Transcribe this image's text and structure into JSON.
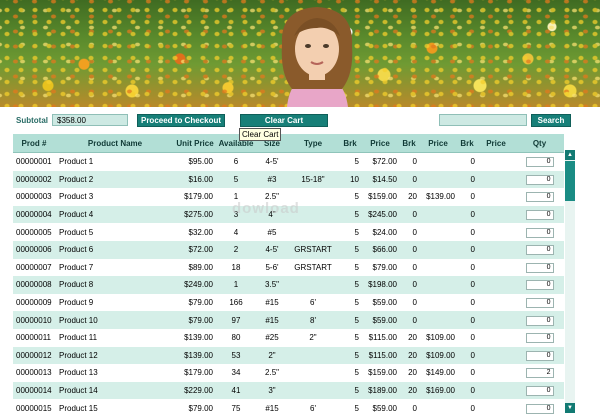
{
  "subtotal": {
    "label": "Subtotal",
    "value": "$358.00"
  },
  "buttons": {
    "checkout": "Proceed to Checkout",
    "clear": "Clear Cart",
    "search": "Search"
  },
  "search": {
    "value": ""
  },
  "tooltip": "Clear Cart",
  "watermark": "dowload",
  "columns": [
    "Prod #",
    "Product Name",
    "Unit Price",
    "Available",
    "Size",
    "Type",
    "Brk",
    "Price",
    "Brk",
    "Price",
    "Brk",
    "Price",
    "Qty"
  ],
  "rows": [
    {
      "prod": "00000001",
      "name": "Product 1",
      "unit": "$95.00",
      "avail": "6",
      "size": "4-5'",
      "type": "",
      "brk1": "5",
      "price1": "$72.00",
      "brk2": "0",
      "price2": "",
      "brk3": "0",
      "price3": "",
      "qty": "0"
    },
    {
      "prod": "00000002",
      "name": "Product 2",
      "unit": "$16.00",
      "avail": "5",
      "size": "#3",
      "type": "15-18\"",
      "brk1": "10",
      "price1": "$14.50",
      "brk2": "0",
      "price2": "",
      "brk3": "0",
      "price3": "",
      "qty": "0"
    },
    {
      "prod": "00000003",
      "name": "Product 3",
      "unit": "$179.00",
      "avail": "1",
      "size": "2.5\"",
      "type": "",
      "brk1": "5",
      "price1": "$159.00",
      "brk2": "20",
      "price2": "$139.00",
      "brk3": "0",
      "price3": "",
      "qty": "0"
    },
    {
      "prod": "00000004",
      "name": "Product 4",
      "unit": "$275.00",
      "avail": "3",
      "size": "4\"",
      "type": "",
      "brk1": "5",
      "price1": "$245.00",
      "brk2": "0",
      "price2": "",
      "brk3": "0",
      "price3": "",
      "qty": "0"
    },
    {
      "prod": "00000005",
      "name": "Product 5",
      "unit": "$32.00",
      "avail": "4",
      "size": "#5",
      "type": "",
      "brk1": "5",
      "price1": "$24.00",
      "brk2": "0",
      "price2": "",
      "brk3": "0",
      "price3": "",
      "qty": "0"
    },
    {
      "prod": "00000006",
      "name": "Product 6",
      "unit": "$72.00",
      "avail": "2",
      "size": "4-5'",
      "type": "GRSTART",
      "brk1": "5",
      "price1": "$66.00",
      "brk2": "0",
      "price2": "",
      "brk3": "0",
      "price3": "",
      "qty": "0"
    },
    {
      "prod": "00000007",
      "name": "Product 7",
      "unit": "$89.00",
      "avail": "18",
      "size": "5-6'",
      "type": "GRSTART",
      "brk1": "5",
      "price1": "$79.00",
      "brk2": "0",
      "price2": "",
      "brk3": "0",
      "price3": "",
      "qty": "0"
    },
    {
      "prod": "00000008",
      "name": "Product 8",
      "unit": "$249.00",
      "avail": "1",
      "size": "3.5\"",
      "type": "",
      "brk1": "5",
      "price1": "$198.00",
      "brk2": "0",
      "price2": "",
      "brk3": "0",
      "price3": "",
      "qty": "0"
    },
    {
      "prod": "00000009",
      "name": "Product 9",
      "unit": "$79.00",
      "avail": "166",
      "size": "#15",
      "type": "6'",
      "brk1": "5",
      "price1": "$59.00",
      "brk2": "0",
      "price2": "",
      "brk3": "0",
      "price3": "",
      "qty": "0"
    },
    {
      "prod": "00000010",
      "name": "Product 10",
      "unit": "$79.00",
      "avail": "97",
      "size": "#15",
      "type": "8'",
      "brk1": "5",
      "price1": "$59.00",
      "brk2": "0",
      "price2": "",
      "brk3": "0",
      "price3": "",
      "qty": "0"
    },
    {
      "prod": "00000011",
      "name": "Product 11",
      "unit": "$139.00",
      "avail": "80",
      "size": "#25",
      "type": "2\"",
      "brk1": "5",
      "price1": "$115.00",
      "brk2": "20",
      "price2": "$109.00",
      "brk3": "0",
      "price3": "",
      "qty": "0"
    },
    {
      "prod": "00000012",
      "name": "Product 12",
      "unit": "$139.00",
      "avail": "53",
      "size": "2\"",
      "type": "",
      "brk1": "5",
      "price1": "$115.00",
      "brk2": "20",
      "price2": "$109.00",
      "brk3": "0",
      "price3": "",
      "qty": "0"
    },
    {
      "prod": "00000013",
      "name": "Product 13",
      "unit": "$179.00",
      "avail": "34",
      "size": "2.5\"",
      "type": "",
      "brk1": "5",
      "price1": "$159.00",
      "brk2": "20",
      "price2": "$149.00",
      "brk3": "0",
      "price3": "",
      "qty": "2"
    },
    {
      "prod": "00000014",
      "name": "Product 14",
      "unit": "$229.00",
      "avail": "41",
      "size": "3\"",
      "type": "",
      "brk1": "5",
      "price1": "$189.00",
      "brk2": "20",
      "price2": "$169.00",
      "brk3": "0",
      "price3": "",
      "qty": "0"
    },
    {
      "prod": "00000015",
      "name": "Product 15",
      "unit": "$79.00",
      "avail": "75",
      "size": "#15",
      "type": "6'",
      "brk1": "5",
      "price1": "$59.00",
      "brk2": "0",
      "price2": "",
      "brk3": "0",
      "price3": "",
      "qty": "0"
    }
  ]
}
